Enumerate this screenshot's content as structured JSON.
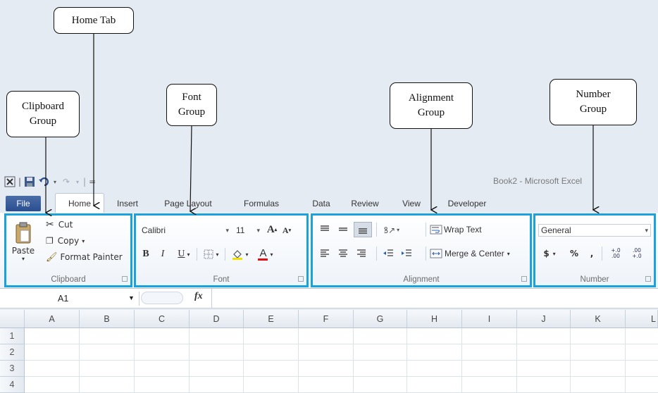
{
  "callouts": {
    "home_tab": "Home Tab",
    "clipboard_line1": "Clipboard",
    "clipboard_line2": "Group",
    "font_line1": "Font",
    "font_line2": "Group",
    "alignment_line1": "Alignment",
    "alignment_line2": "Group",
    "number_line1": "Number",
    "number_line2": "Group"
  },
  "window": {
    "title": "Book2 - Microsoft Excel",
    "qat_separator": "|",
    "qat_customize": "="
  },
  "tabs": {
    "file": "File",
    "home": "Home",
    "insert": "Insert",
    "page_layout": "Page Layout",
    "formulas": "Formulas",
    "data": "Data",
    "review": "Review",
    "view": "View",
    "developer": "Developer"
  },
  "clipboard": {
    "paste": "Paste",
    "cut": "Cut",
    "copy": "Copy",
    "format_painter": "Format Painter",
    "label": "Clipboard"
  },
  "font": {
    "font_name": "Calibri",
    "font_size": "11",
    "bold": "B",
    "italic": "I",
    "underline": "U",
    "grow": "A",
    "shrink": "A",
    "font_color": "A",
    "label": "Font"
  },
  "alignment": {
    "wrap_text": "Wrap Text",
    "merge_center": "Merge & Center",
    "label": "Alignment"
  },
  "number": {
    "format": "General",
    "currency": "$",
    "percent": "%",
    "comma": ",",
    "inc_decimal": "+.0 .00",
    "dec_decimal": ".00 +.0",
    "label": "Number"
  },
  "formula_bar": {
    "name_box": "A1",
    "fx": "fx"
  },
  "sheet": {
    "columns": [
      "A",
      "B",
      "C",
      "D",
      "E",
      "F",
      "G",
      "H",
      "I",
      "J",
      "K",
      "L"
    ],
    "rows": [
      "1",
      "2",
      "3",
      "4"
    ]
  },
  "colors": {
    "group_highlight": "#19a2dc",
    "file_tab": "#2f5597"
  }
}
